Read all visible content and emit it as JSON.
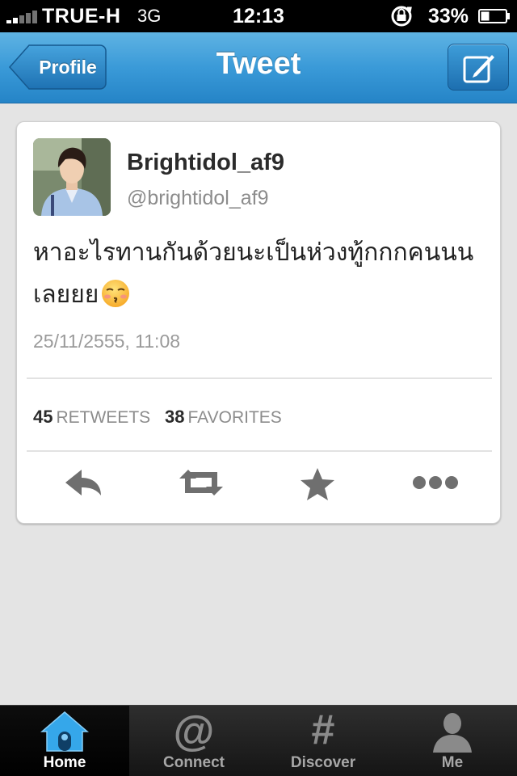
{
  "status_bar": {
    "carrier": "TRUE-H",
    "network": "3G",
    "time": "12:13",
    "battery": "33%"
  },
  "nav": {
    "back_label": "Profile",
    "title": "Tweet",
    "compose_icon": "compose-icon"
  },
  "tweet": {
    "display_name": "Brightidol_af9",
    "handle": "@brightidol_af9",
    "text": "หาอะไรทานกันด้วยนะเป็นห่วงทู้กกกคนนนเลยยย",
    "emoji": "kissing-face-icon",
    "timestamp": "25/11/2555, 11:08",
    "retweets_count": "45",
    "retweets_label": "RETWEETS",
    "favorites_count": "38",
    "favorites_label": "FAVORITES",
    "actions": [
      "reply-icon",
      "retweet-icon",
      "favorite-icon",
      "more-icon"
    ]
  },
  "tab_bar": {
    "tabs": [
      {
        "label": "Home",
        "icon": "home-icon",
        "active": true
      },
      {
        "label": "Connect",
        "icon": "at-icon",
        "active": false
      },
      {
        "label": "Discover",
        "icon": "hash-icon",
        "active": false
      },
      {
        "label": "Me",
        "icon": "person-icon",
        "active": false
      }
    ]
  },
  "colors": {
    "nav_blue": "#3a9ad8",
    "home_blue": "#2ea1e4",
    "tab_bar": "#1c1c1c"
  }
}
